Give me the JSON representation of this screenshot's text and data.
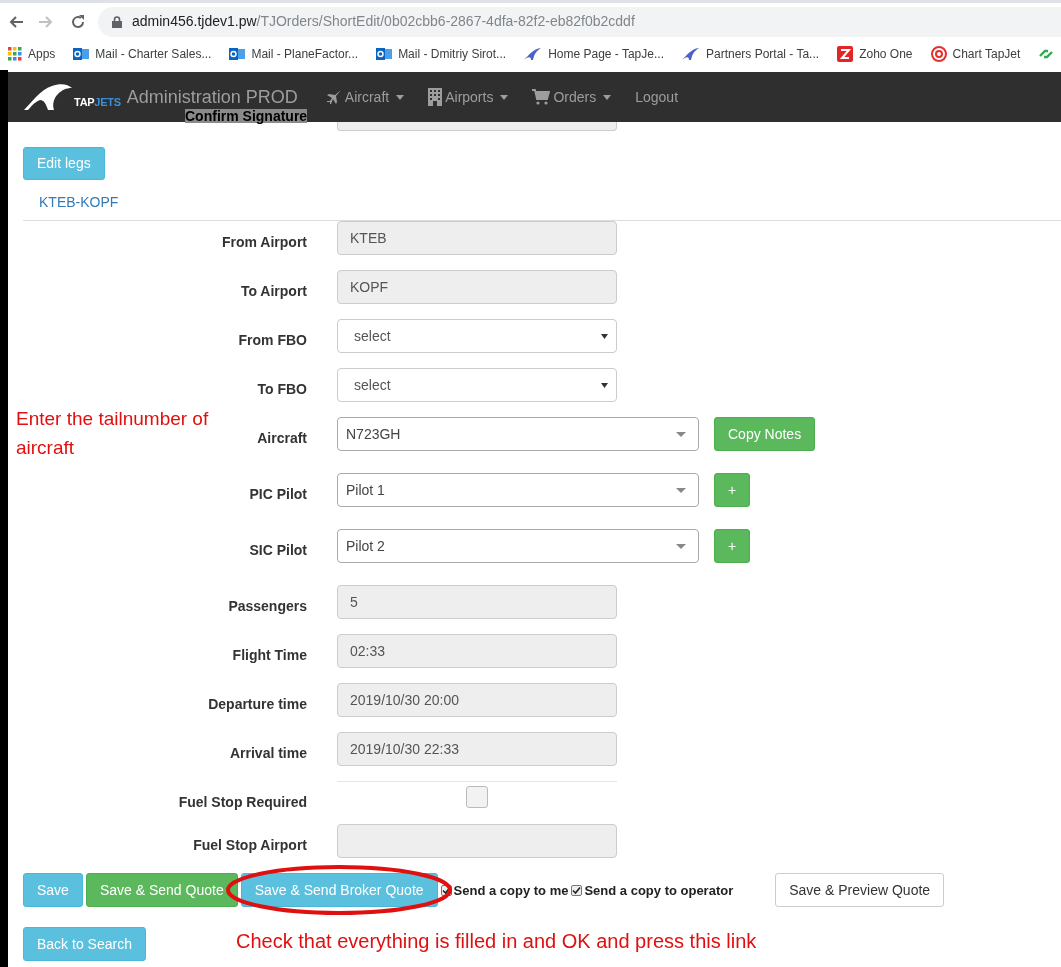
{
  "browser": {
    "url_host": "admin456.tjdev1.pw",
    "url_path": "/TJOrders/ShortEdit/0b02cbb6-2867-4dfa-82f2-eb82f0b2cddf",
    "bookmarks": [
      {
        "kind": "apps",
        "label": "Apps"
      },
      {
        "kind": "outlook",
        "label": "Mail - Charter Sales..."
      },
      {
        "kind": "outlook",
        "label": "Mail - PlaneFactor..."
      },
      {
        "kind": "outlook",
        "label": "Mail - Dmitriy Sirot..."
      },
      {
        "kind": "swoosh",
        "label": "Home Page - TapJe..."
      },
      {
        "kind": "swoosh",
        "label": "Partners Portal - Ta..."
      },
      {
        "kind": "zoho",
        "label": "Zoho One"
      },
      {
        "kind": "target",
        "label": "Chart TapJet"
      },
      {
        "kind": "chain"
      }
    ]
  },
  "navbar": {
    "logo_text": "TAP",
    "logo_text_2": "JETS",
    "title": "Administration PROD",
    "menu": [
      {
        "kind": "plane",
        "label": "Aircraft",
        "dropdown": true
      },
      {
        "kind": "building",
        "label": "Airports",
        "dropdown": true
      },
      {
        "kind": "cart",
        "label": "Orders",
        "dropdown": true
      },
      {
        "kind": "plain",
        "label": "Logout",
        "dropdown": false
      }
    ]
  },
  "hidden_row": {
    "label": "Confirm Signature"
  },
  "edit_legs_button": "Edit legs",
  "leg_link": "KTEB-KOPF",
  "fields": [
    {
      "kind": "text",
      "label": "From Airport",
      "value": "KTEB"
    },
    {
      "kind": "text",
      "label": "To Airport",
      "value": "KOPF"
    },
    {
      "kind": "select",
      "label": "From FBO",
      "value": "select"
    },
    {
      "kind": "select",
      "label": "To FBO",
      "value": "select"
    },
    {
      "kind": "combo",
      "label": "Aircraft",
      "value": "N723GH",
      "button": "Copy Notes"
    },
    {
      "kind": "combo",
      "label": "PIC Pilot",
      "value": "Pilot 1",
      "button": "+"
    },
    {
      "kind": "combo",
      "label": "SIC Pilot",
      "value": "Pilot 2",
      "button": "+"
    },
    {
      "kind": "text",
      "label": "Passengers",
      "value": "5"
    },
    {
      "kind": "text",
      "label": "Flight Time",
      "value": "02:33"
    },
    {
      "kind": "text",
      "label": "Departure time",
      "value": "2019/10/30 20:00"
    },
    {
      "kind": "text",
      "label": "Arrival time",
      "value": "2019/10/30 22:33"
    },
    {
      "kind": "checkbox",
      "label": "Fuel Stop Required",
      "checked": false
    },
    {
      "kind": "text",
      "label": "Fuel Stop Airport"
    }
  ],
  "actions": [
    {
      "kind": "info",
      "label": "Save"
    },
    {
      "kind": "success",
      "label": "Save & Send Quote"
    },
    {
      "kind": "info",
      "label": "Save & Send Broker Quote",
      "circled": true
    },
    {
      "kind": "checkbox",
      "label": "Send a copy to me",
      "checked": true
    },
    {
      "kind": "checkbox",
      "label": "Send a copy to operator",
      "checked": true
    },
    {
      "kind": "plain",
      "label": "Save & Preview Quote"
    }
  ],
  "back_button": "Back to Search",
  "annotations": [
    {
      "text": "Enter the tailnumber of aircraft"
    },
    {
      "text": "Check that everything is filled in and OK and press this link"
    }
  ]
}
